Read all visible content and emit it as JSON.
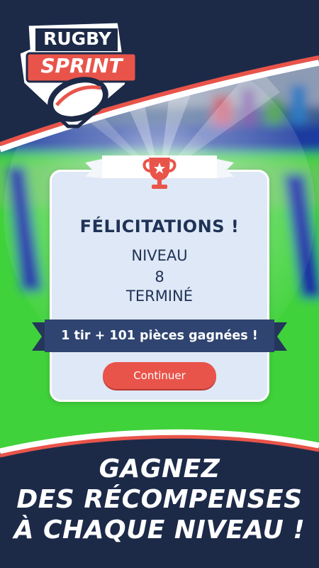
{
  "logo": {
    "line1": "RUGBY",
    "line2": "SPRINT"
  },
  "dialog": {
    "title": "FÉLICITATIONS !",
    "level_label": "NIVEAU",
    "level_number": "8",
    "level_status": "TERMINÉ",
    "reward": "1 tir + 101 pièces gagnées !",
    "continue_label": "Continuer"
  },
  "promo": {
    "line1": "GAGNEZ",
    "line2": "DES RÉCOMPENSES",
    "line3": "À CHAQUE NIVEAU !"
  },
  "colors": {
    "navy": "#1c2a48",
    "accent_red": "#e9544a",
    "panel": "#dfe8f6",
    "field_green": "#3fd23a"
  },
  "icons": {
    "trophy": "trophy-icon"
  }
}
